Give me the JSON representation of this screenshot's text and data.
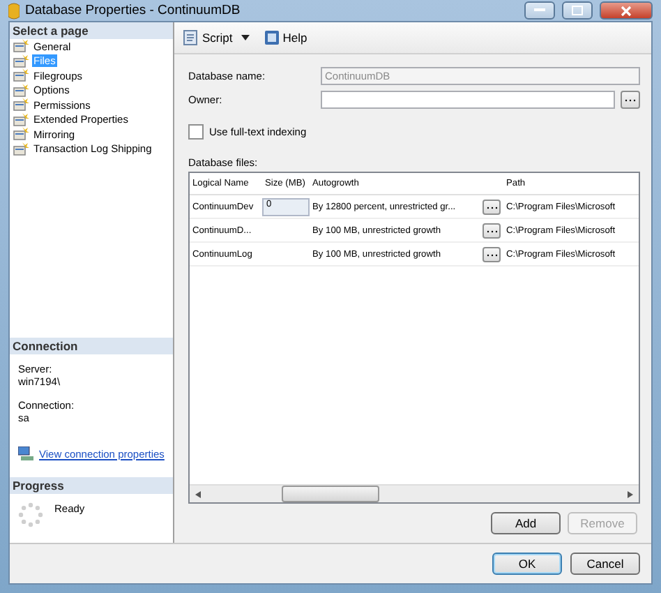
{
  "window": {
    "title": "Database Properties - ContinuumDB"
  },
  "sidebar": {
    "header": "Select a page",
    "pages": [
      {
        "label": "General",
        "selected": false
      },
      {
        "label": "Files",
        "selected": true
      },
      {
        "label": "Filegroups",
        "selected": false
      },
      {
        "label": "Options",
        "selected": false
      },
      {
        "label": "Permissions",
        "selected": false
      },
      {
        "label": "Extended Properties",
        "selected": false
      },
      {
        "label": "Mirroring",
        "selected": false
      },
      {
        "label": "Transaction Log Shipping",
        "selected": false
      }
    ]
  },
  "connection": {
    "header": "Connection",
    "server_label": "Server:",
    "server": "win7194\\",
    "connection_label": "Connection:",
    "connection": "sa",
    "link": "View connection properties"
  },
  "progress": {
    "header": "Progress",
    "status": "Ready"
  },
  "toolbar": [
    {
      "label": "Script",
      "kind": "dropdown"
    },
    {
      "label": "Help",
      "kind": "help"
    }
  ],
  "form": {
    "database_name": {
      "label": "Database name:",
      "value": "ContinuumDB",
      "disabled": true
    },
    "owner": {
      "label": "Owner:"
    },
    "full_text": {
      "label": "Use full-text indexing",
      "checked": false
    }
  },
  "files": {
    "label": "Database files:",
    "columns": [
      "Logical Name",
      "Size (MB)",
      "Autogrowth",
      "Path"
    ],
    "rows": [
      {
        "logical_name": "ContinuumDev",
        "size": "0",
        "autogrowth": "By 12800 percent, unrestricted gr...",
        "path": "C:\\Program Files\\Microsoft"
      },
      {
        "logical_name": "ContinuumD...",
        "autogrowth": "By 100 MB, unrestricted growth",
        "path": "C:\\Program Files\\Microsoft"
      },
      {
        "logical_name": "ContinuumLog",
        "autogrowth": "By 100 MB, unrestricted growth",
        "path": "C:\\Program Files\\Microsoft"
      }
    ],
    "buttons": [
      {
        "label": "Add",
        "disabled": false
      },
      {
        "label": "Remove",
        "disabled": true
      }
    ]
  },
  "footer": [
    {
      "label": "OK",
      "default": true
    },
    {
      "label": "Cancel",
      "default": false
    }
  ]
}
